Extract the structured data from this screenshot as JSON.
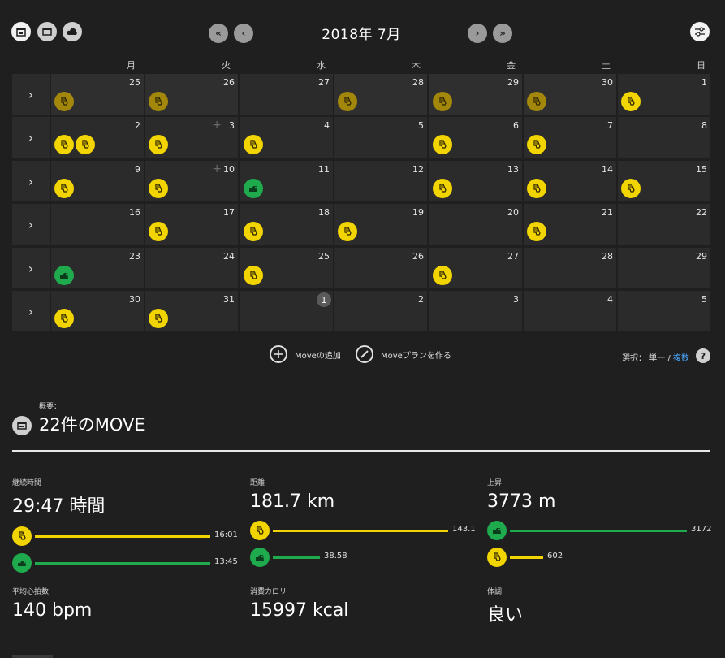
{
  "header": {
    "title": "2018年 7月",
    "view_icons": [
      "calendar-icon",
      "list-icon",
      "cloud-icon"
    ],
    "nav": {
      "first": "«",
      "prev": "‹",
      "next": "›",
      "last": "»"
    },
    "settings_icon": "sliders-icon"
  },
  "weekdays": [
    "月",
    "火",
    "水",
    "木",
    "金",
    "土",
    "日"
  ],
  "row_toggle": "›",
  "weeks": [
    {
      "days": [
        {
          "num": "25",
          "acts": [
            "run"
          ],
          "past": true
        },
        {
          "num": "26",
          "acts": [
            "run"
          ],
          "past": true
        },
        {
          "num": "27",
          "acts": []
        },
        {
          "num": "28",
          "acts": [
            "run"
          ],
          "past": true
        },
        {
          "num": "29",
          "acts": [
            "run"
          ],
          "past": true
        },
        {
          "num": "30",
          "acts": [
            "run"
          ],
          "past": true
        },
        {
          "num": "1",
          "acts": [
            "run"
          ]
        }
      ]
    },
    {
      "days": [
        {
          "num": "2",
          "acts": [
            "run",
            "run"
          ]
        },
        {
          "num": "3",
          "acts": [
            "run"
          ],
          "plus": true
        },
        {
          "num": "4",
          "acts": [
            "run"
          ]
        },
        {
          "num": "5",
          "acts": []
        },
        {
          "num": "6",
          "acts": [
            "run"
          ]
        },
        {
          "num": "7",
          "acts": [
            "run"
          ]
        },
        {
          "num": "8",
          "acts": []
        }
      ]
    },
    {
      "days": [
        {
          "num": "9",
          "acts": [
            "run"
          ]
        },
        {
          "num": "10",
          "acts": [
            "run"
          ],
          "plus": true
        },
        {
          "num": "11",
          "acts": [
            "bike"
          ]
        },
        {
          "num": "12",
          "acts": []
        },
        {
          "num": "13",
          "acts": [
            "run"
          ]
        },
        {
          "num": "14",
          "acts": [
            "run"
          ]
        },
        {
          "num": "15",
          "acts": [
            "run"
          ]
        }
      ]
    },
    {
      "days": [
        {
          "num": "16",
          "acts": []
        },
        {
          "num": "17",
          "acts": [
            "run"
          ]
        },
        {
          "num": "18",
          "acts": [
            "run"
          ]
        },
        {
          "num": "19",
          "acts": [
            "run"
          ]
        },
        {
          "num": "20",
          "acts": []
        },
        {
          "num": "21",
          "acts": [
            "run"
          ]
        },
        {
          "num": "22",
          "acts": []
        }
      ]
    },
    {
      "days": [
        {
          "num": "23",
          "acts": [
            "bike"
          ]
        },
        {
          "num": "24",
          "acts": []
        },
        {
          "num": "25",
          "acts": [
            "run"
          ]
        },
        {
          "num": "26",
          "acts": []
        },
        {
          "num": "27",
          "acts": [
            "run"
          ]
        },
        {
          "num": "28",
          "acts": []
        },
        {
          "num": "29",
          "acts": []
        }
      ]
    },
    {
      "days": [
        {
          "num": "30",
          "acts": [
            "run"
          ]
        },
        {
          "num": "31",
          "acts": [
            "run"
          ]
        },
        {
          "num": "1",
          "acts": [],
          "today": true
        },
        {
          "num": "2",
          "acts": []
        },
        {
          "num": "3",
          "acts": []
        },
        {
          "num": "4",
          "acts": []
        },
        {
          "num": "5",
          "acts": []
        }
      ]
    }
  ],
  "actions": {
    "add_move": "Moveの追加",
    "create_plan": "Moveプランを作る",
    "select_label": "選択：",
    "single": "単一",
    "separator": "/",
    "multiple": "複数",
    "help": "?"
  },
  "summary": {
    "label": "概要：",
    "title": "22件のMOVE",
    "stats": {
      "duration": {
        "label": "継続時間",
        "value": "29:47 時間",
        "bars": [
          {
            "type": "run",
            "value": "16:01",
            "fraction": 1.0
          },
          {
            "type": "bike",
            "value": "13:45",
            "fraction": 1.0
          }
        ]
      },
      "distance": {
        "label": "距離",
        "value": "181.7 km",
        "bars": [
          {
            "type": "run",
            "value": "143.1",
            "fraction": 1.0
          },
          {
            "type": "bike",
            "value": "38.58",
            "fraction": 0.27
          }
        ]
      },
      "ascent": {
        "label": "上昇",
        "value": "3773 m",
        "bars": [
          {
            "type": "bike",
            "value": "3172",
            "fraction": 1.0
          },
          {
            "type": "run",
            "value": "602",
            "fraction": 0.19
          }
        ]
      },
      "heart_rate": {
        "label": "平均心拍数",
        "value": "140 bpm"
      },
      "calories": {
        "label": "消費カロリー",
        "value": "15997 kcal"
      },
      "condition": {
        "label": "体調",
        "value": "良い"
      }
    }
  },
  "colors": {
    "run": "#f2d400",
    "run_past": "#a3870a",
    "bike": "#1faa4e",
    "bar_run": "#f2d400",
    "bar_bike": "#1faa4e",
    "link": "#4aa8ff"
  }
}
